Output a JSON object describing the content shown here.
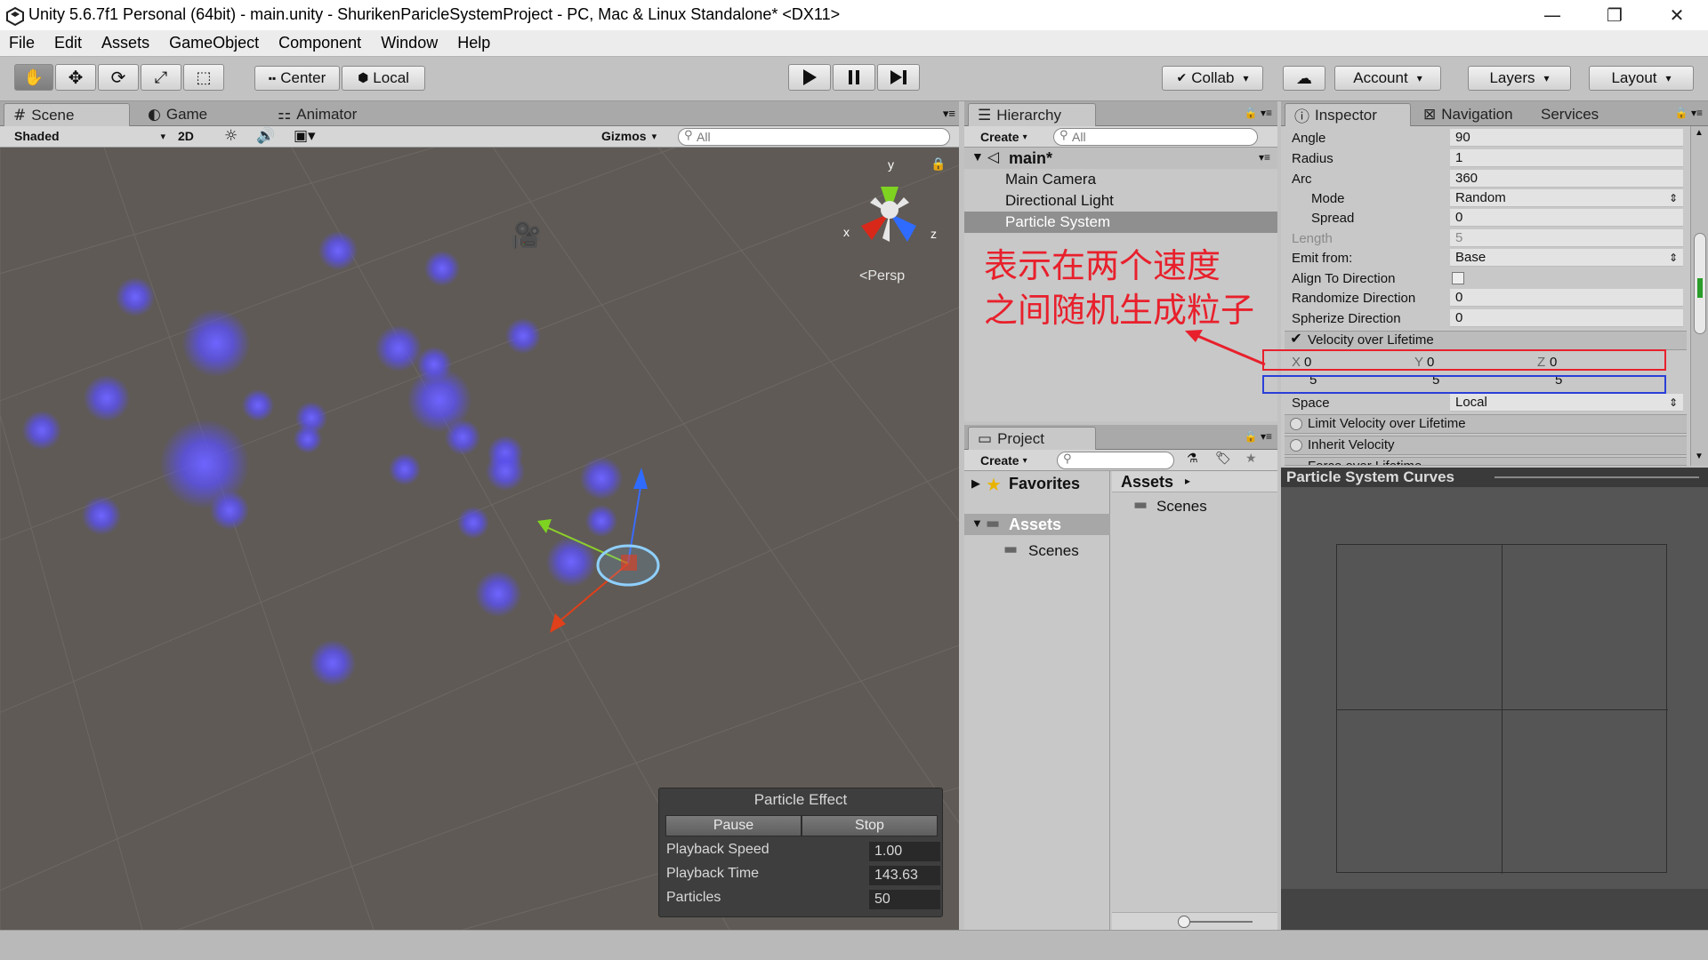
{
  "window": {
    "title": "Unity 5.6.7f1 Personal (64bit) - main.unity - ShurikenParicleSystemProject - PC, Mac & Linux Standalone* <DX11>",
    "minimize": "—",
    "maximize": "❐",
    "close": "✕"
  },
  "menu": [
    "File",
    "Edit",
    "Assets",
    "GameObject",
    "Component",
    "Window",
    "Help"
  ],
  "toolbar": {
    "pivot": "Center",
    "space": "Local",
    "collab": "Collab",
    "account": "Account",
    "layers": "Layers",
    "layout": "Layout"
  },
  "scene": {
    "tabs": [
      "Scene",
      "Game",
      "Animator"
    ],
    "shading": "Shaded",
    "mode_2d": "2D",
    "gizmos": "Gizmos",
    "search_placeholder": "All",
    "persp": "Persp",
    "axis_x": "x",
    "axis_y": "y",
    "axis_z": "z"
  },
  "particle_effect": {
    "title": "Particle Effect",
    "pause": "Pause",
    "stop": "Stop",
    "playback_speed_label": "Playback Speed",
    "playback_speed": "1.00",
    "playback_time_label": "Playback Time",
    "playback_time": "143.63",
    "particles_label": "Particles",
    "particles": "50"
  },
  "hierarchy": {
    "tab": "Hierarchy",
    "create": "Create",
    "search_placeholder": "All",
    "scene": "main*",
    "items": [
      "Main Camera",
      "Directional Light",
      "Particle System"
    ],
    "annotation_line1": "表示在两个速度",
    "annotation_line2": "之间随机生成粒子"
  },
  "project": {
    "tab": "Project",
    "create": "Create",
    "favorites": "Favorites",
    "assets": "Assets",
    "scenes": "Scenes",
    "breadcrumb": "Assets",
    "folder": "Scenes"
  },
  "inspector": {
    "tabs": [
      "Inspector",
      "Navigation",
      "Services"
    ],
    "rows": [
      {
        "label": "Angle",
        "value": "90"
      },
      {
        "label": "Radius",
        "value": "1"
      },
      {
        "label": "Arc",
        "value": "360"
      },
      {
        "label": "Mode",
        "value": "Random"
      },
      {
        "label": "Spread",
        "value": "0"
      },
      {
        "label": "Length",
        "value": "5"
      },
      {
        "label": "Emit from:",
        "value": "Base"
      },
      {
        "label": "Align To Direction",
        "value": ""
      },
      {
        "label": "Randomize Direction",
        "value": "0"
      },
      {
        "label": "Spherize Direction",
        "value": "0"
      }
    ],
    "velocity_section": "Velocity over Lifetime",
    "velocity_min": {
      "x": "0",
      "y": "0",
      "z": "0"
    },
    "velocity_max": {
      "x": "5",
      "y": "5",
      "z": "5"
    },
    "axis_x": "X",
    "axis_y": "Y",
    "axis_z": "Z",
    "space_label": "Space",
    "space_value": "Local",
    "limit_velocity": "Limit Velocity over Lifetime",
    "inherit_velocity": "Inherit Velocity",
    "force_partial": "Force over Lifetime"
  },
  "curves": {
    "title": "Particle System Curves"
  },
  "colors": {
    "annotation": "#e8202c",
    "red_box": "#e8202c",
    "blue_box": "#2a3fd8",
    "particle": "#5a4ff0"
  }
}
